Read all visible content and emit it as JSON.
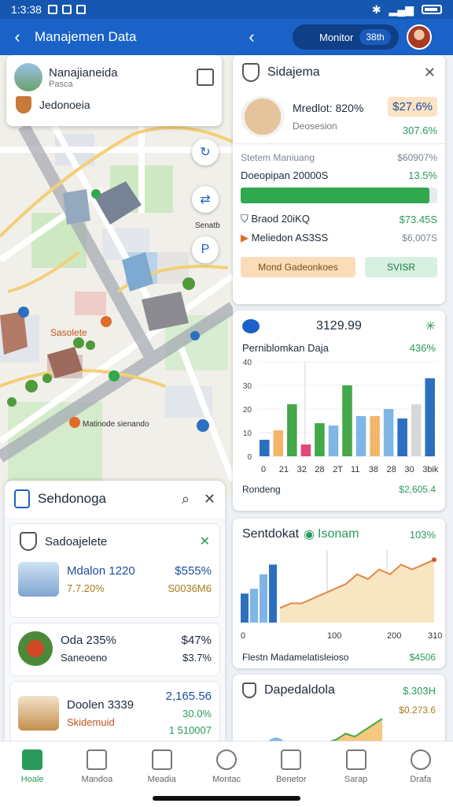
{
  "status_bar": {
    "time": "1:3:38"
  },
  "app_bar": {
    "title": "Manajemen Data",
    "right_pill_label": "Monitor",
    "right_pill_badge": "38th"
  },
  "map": {
    "place_card": {
      "title": "Nanajianeida",
      "subtitle": "Pasca",
      "row_label": "Jedonoeia"
    },
    "labels": [
      "Sasolete",
      "Matinode sienando",
      "Senatb"
    ]
  },
  "search_panel": {
    "title": "Sehdonoga",
    "list_header": "Sadoajelete",
    "items": [
      {
        "name": "Mdalon 1220",
        "sub": "7.7.20%",
        "value": "$555%",
        "value2": "S0036M6"
      },
      {
        "name": "Oda 235%",
        "sub": "Saneoeno",
        "value": "$47%",
        "value2": "$3.7%"
      },
      {
        "name": "Doolen 3339",
        "sub": "Skidemuid",
        "value": "2,165.56",
        "value2": "30.0%"
      }
    ],
    "footer_value": "1 510007"
  },
  "card1": {
    "title": "Sidajema",
    "detail_title": "Mredlot: 820%",
    "detail_sub": "Deosesion",
    "detail_price": "$27.6%",
    "detail_price2": "307.6%",
    "section_label": "Stetem Maniuang",
    "section_value": "$60907%",
    "progress_label": "Doeopipan 20000S",
    "progress_value": "13.5%",
    "progress_fraction": 0.96,
    "row1_label": "Braod 20iKQ",
    "row1_value": "$73.45S",
    "row2_label": "Meliedon AS3SS",
    "row2_value": "$6,007S",
    "btn_primary": "Mond Gadeonkoes",
    "btn_secondary": "SVISR"
  },
  "card2": {
    "title": "3129.99",
    "subtitle": "Perniblomkan Daja",
    "sub_value": "436%",
    "footer_label": "Rondeng",
    "footer_value": "$2,605.4"
  },
  "card3": {
    "title": "Sentdokat",
    "tag": "Isonam",
    "value": "103%",
    "footer_label": "Flestn Madamelatisleioso",
    "footer_value": "$4506"
  },
  "card4": {
    "title": "Dapedaldola",
    "value": "$.303H",
    "value2": "$0.273.6"
  },
  "chart_data": [
    {
      "type": "bar",
      "title": "3129.99",
      "categories": [
        "0",
        "21",
        "32",
        "28",
        "2T",
        "11",
        "38",
        "28",
        "30",
        "3bik"
      ],
      "yticks": [
        0,
        10,
        20,
        30,
        40
      ],
      "series": [
        {
          "values": [
            7,
            11,
            22,
            5,
            14,
            13,
            30,
            17,
            17,
            20,
            16,
            22,
            33
          ]
        }
      ],
      "colors": [
        "#2c6fbf",
        "#f4b56a",
        "#43a84a",
        "#e0487a",
        "#43a84a",
        "#7fb6e6",
        "#43a84a",
        "#7fb6e6",
        "#f4b56a",
        "#7fb6e6",
        "#2c6fbf",
        "#d7d7d7"
      ],
      "ylim": [
        0,
        40
      ]
    },
    {
      "type": "area",
      "title": "Sentdokat",
      "x": [
        0,
        100,
        200,
        300
      ],
      "xticks": [
        "0",
        "100",
        "200",
        "310"
      ],
      "bars": [
        6,
        7,
        10,
        12
      ],
      "area": [
        3,
        4,
        4,
        5,
        6,
        7,
        8,
        10,
        9,
        11,
        10,
        12,
        11,
        12,
        13
      ],
      "ylim": [
        0,
        15
      ]
    },
    {
      "type": "area",
      "title": "Dapedaldola",
      "area": [
        1,
        2,
        4,
        3,
        5,
        7,
        9
      ]
    }
  ],
  "bottom_nav": [
    {
      "label": "Hoale",
      "icon": "home-icon"
    },
    {
      "label": "Mandoa",
      "icon": "store-icon"
    },
    {
      "label": "Meadia",
      "icon": "media-icon"
    },
    {
      "label": "Montac",
      "icon": "search-icon"
    },
    {
      "label": "Benetor",
      "icon": "document-icon"
    },
    {
      "label": "Sarap",
      "icon": "inbox-icon"
    },
    {
      "label": "Drafa",
      "icon": "profile-icon"
    }
  ]
}
